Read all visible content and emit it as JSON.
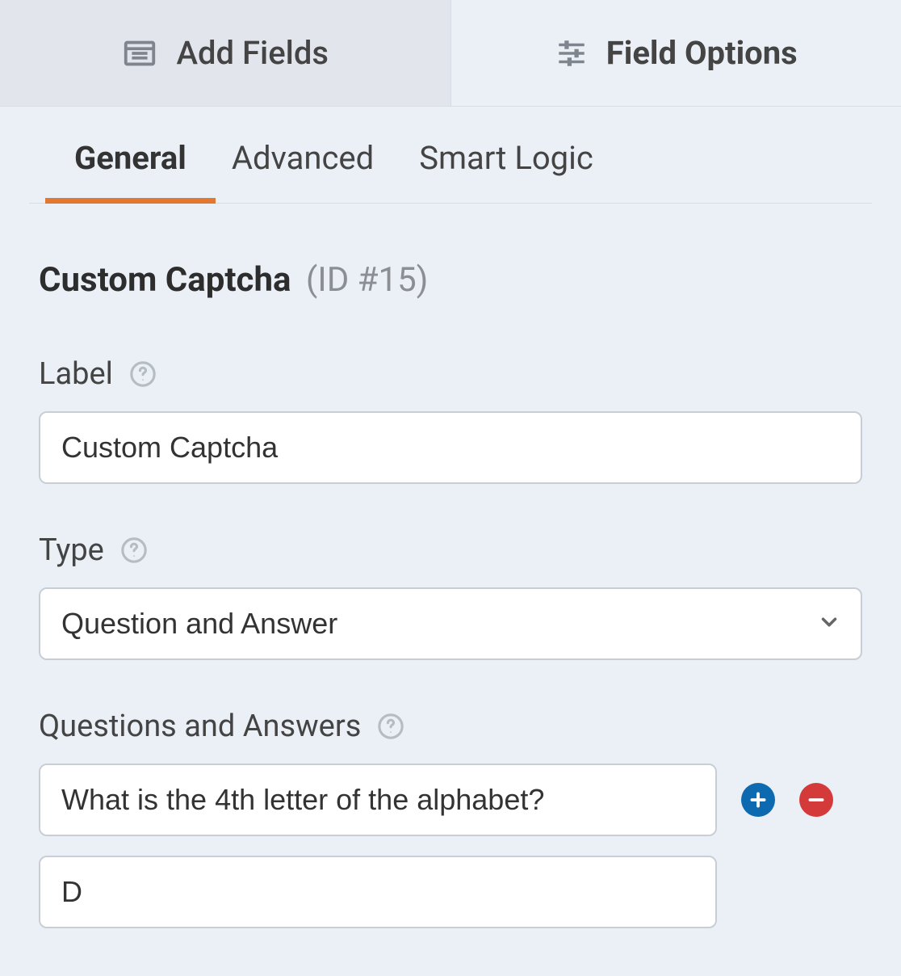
{
  "topTabs": {
    "addFields": "Add Fields",
    "fieldOptions": "Field Options"
  },
  "subTabs": {
    "general": "General",
    "advanced": "Advanced",
    "smartLogic": "Smart Logic"
  },
  "field": {
    "title": "Custom Captcha",
    "idTag": "(ID #15)"
  },
  "labelSection": {
    "label": "Label",
    "value": "Custom Captcha"
  },
  "typeSection": {
    "label": "Type",
    "value": "Question and Answer"
  },
  "qaSection": {
    "label": "Questions and Answers",
    "question": "What is the 4th letter of the alphabet?",
    "answer": "D"
  }
}
